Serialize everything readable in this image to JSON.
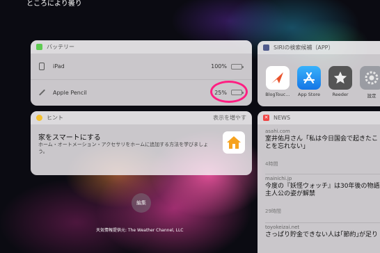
{
  "status": {
    "weather_text": "ところにより曇り"
  },
  "battery_widget": {
    "title": "バッテリー",
    "devices": [
      {
        "name": "iPad",
        "percent": "100%",
        "level": 1.0
      },
      {
        "name": "Apple Pencil",
        "percent": "25%",
        "level": 0.25
      }
    ],
    "highlight_color": "#ff1f82"
  },
  "hint_widget": {
    "title": "ヒント",
    "more_label": "表示を増やす",
    "heading": "家をスマートにする",
    "body": "ホーム・オートメーション・アクセサリをホームに追加する方法を学びましょう。"
  },
  "siri_widget": {
    "title": "SIRIの検索候補（APP）",
    "apps": [
      {
        "label": "BlogTouc…",
        "icon": "blogtouch-icon"
      },
      {
        "label": "App Store",
        "icon": "app-store-icon"
      },
      {
        "label": "Reeder",
        "icon": "reeder-icon"
      },
      {
        "label": "設定",
        "icon": "settings-icon"
      }
    ]
  },
  "news_widget": {
    "title": "NEWS",
    "items": [
      {
        "source": "asahi.com",
        "line1": "室井佑月さん「私は今日国会で起きたこ",
        "line2": "とを忘れない」",
        "time": "4時間"
      },
      {
        "source": "mainichi.jp",
        "line1": "今度の『妖怪ウォッチ』は30年後の物語",
        "line2": "主人公の姿が解禁",
        "time": "29時間"
      },
      {
        "source": "toyokeizai.net",
        "line1": "さっぱり貯金できない人は｢節約｣が足り",
        "line2": "",
        "time": ""
      }
    ]
  },
  "edit_button_label": "編集",
  "weather_credit": "天気情報提供元: The Weather Channel, LLC",
  "colors": {
    "battery_green": "#5ecb52",
    "news_red": "#f04545",
    "app_store_blue": "#1d8ef5"
  }
}
